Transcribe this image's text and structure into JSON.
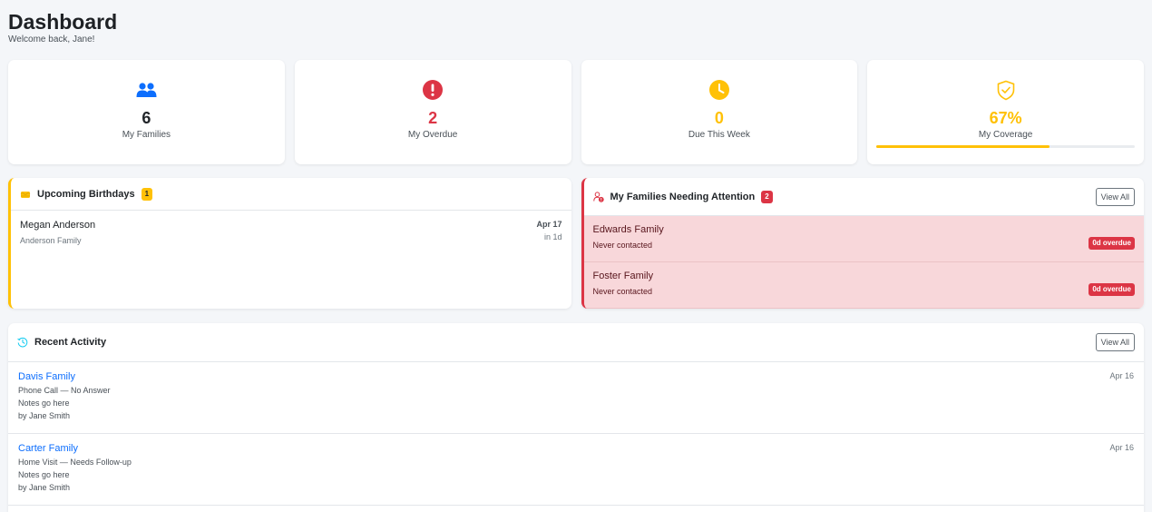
{
  "header": {
    "title": "Dashboard",
    "subtitle": "Welcome back, Jane!"
  },
  "stats": [
    {
      "value": "6",
      "label": "My Families",
      "icon": "people-icon",
      "color": "#0d6efd"
    },
    {
      "value": "2",
      "label": "My Overdue",
      "icon": "exclamation-circle-icon",
      "color": "#dc3545"
    },
    {
      "value": "0",
      "label": "Due This Week",
      "icon": "clock-icon",
      "color": "#ffc107"
    },
    {
      "value": "67%",
      "label": "My Coverage",
      "icon": "shield-check-icon",
      "color": "#ffc107",
      "progress": 0.67
    }
  ],
  "birthdays": {
    "title": "Upcoming Birthdays",
    "count": "1",
    "icon": "cake-icon",
    "items": [
      {
        "name": "Megan Anderson",
        "family": "Anderson Family",
        "date": "Apr 17",
        "in": "in 1d"
      }
    ]
  },
  "attention": {
    "title": "My Families Needing Attention",
    "count": "2",
    "icon": "user-alert-icon",
    "view_all": "View All",
    "items": [
      {
        "name": "Edwards Family",
        "status": "Never contacted",
        "badge": "0d overdue"
      },
      {
        "name": "Foster Family",
        "status": "Never contacted",
        "badge": "0d overdue"
      }
    ]
  },
  "recent": {
    "title": "Recent Activity",
    "icon": "history-icon",
    "view_all": "View All",
    "items": [
      {
        "family": "Davis Family",
        "type": "Phone Call — No Answer",
        "notes": "Notes go here",
        "by": "by Jane Smith",
        "date": "Apr 16"
      },
      {
        "family": "Carter Family",
        "type": "Home Visit — Needs Follow-up",
        "notes": "Notes go here",
        "by": "by Jane Smith",
        "date": "Apr 16"
      }
    ]
  },
  "colors": {
    "primary": "#0d6efd",
    "danger": "#dc3545",
    "warning": "#ffc107",
    "info": "#0dcaf0"
  }
}
